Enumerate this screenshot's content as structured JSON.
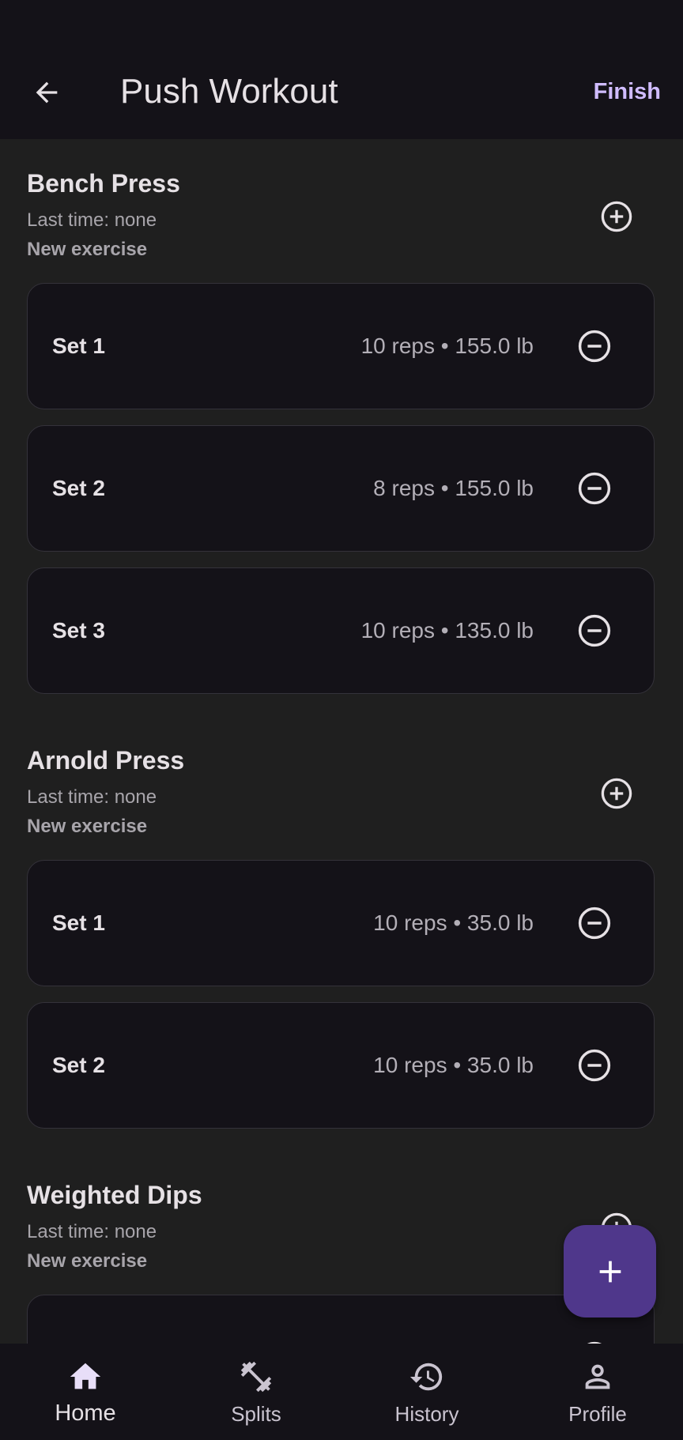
{
  "header": {
    "title": "Push Workout",
    "finish_label": "Finish",
    "back_icon": "arrow-back-icon"
  },
  "exercises": [
    {
      "name": "Bench Press",
      "last_time": "Last time: none",
      "status": "New exercise",
      "sets": [
        {
          "label": "Set 1",
          "detail": "10 reps • 155.0 lb"
        },
        {
          "label": "Set 2",
          "detail": "8 reps • 155.0 lb"
        },
        {
          "label": "Set 3",
          "detail": "10 reps • 135.0 lb"
        }
      ]
    },
    {
      "name": "Arnold Press",
      "last_time": "Last time: none",
      "status": "New exercise",
      "sets": [
        {
          "label": "Set 1",
          "detail": "10 reps • 35.0 lb"
        },
        {
          "label": "Set 2",
          "detail": "10 reps • 35.0 lb"
        }
      ]
    },
    {
      "name": "Weighted Dips",
      "last_time": "Last time: none",
      "status": "New exercise",
      "sets": [
        {
          "label": "",
          "detail": ""
        }
      ]
    }
  ],
  "nav": {
    "items": [
      {
        "label": "Home",
        "icon": "home-icon"
      },
      {
        "label": "Splits",
        "icon": "dumbbell-icon"
      },
      {
        "label": "History",
        "icon": "history-icon"
      },
      {
        "label": "Profile",
        "icon": "person-icon"
      }
    ],
    "active": "Home"
  },
  "colors": {
    "background": "#1f1f1f",
    "surface": "#141218",
    "accent": "#d0bcff",
    "fab": "#4f378b"
  }
}
